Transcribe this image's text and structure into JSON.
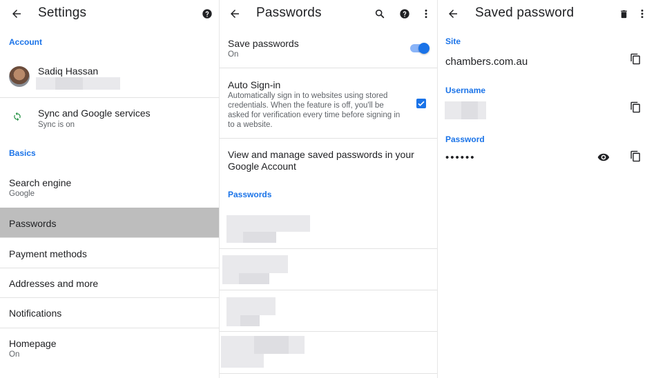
{
  "settings": {
    "title": "Settings",
    "account_label": "Account",
    "user_name": "Sadiq Hassan",
    "sync_title": "Sync and Google services",
    "sync_subtitle": "Sync is on",
    "basics_label": "Basics",
    "search_engine_title": "Search engine",
    "search_engine_value": "Google",
    "passwords": "Passwords",
    "payment_methods": "Payment methods",
    "addresses": "Addresses and more",
    "notifications": "Notifications",
    "homepage_title": "Homepage",
    "homepage_value": "On"
  },
  "passwords": {
    "title": "Passwords",
    "save_passwords_title": "Save passwords",
    "save_passwords_value": "On",
    "save_passwords_enabled": true,
    "auto_signin_title": "Auto Sign-in",
    "auto_signin_desc": "Automatically sign in to websites using stored credentials. When the feature is off, you'll be asked for verification every time before signing in to a website.",
    "auto_signin_checked": true,
    "manage_text": "View and manage saved passwords in your",
    "manage_link": "Google Account",
    "list_label": "Passwords"
  },
  "saved_password": {
    "title": "Saved password",
    "site_label": "Site",
    "site_value": "chambers.com.au",
    "username_label": "Username",
    "password_label": "Password",
    "password_masked": "••••••"
  },
  "colors": {
    "accent": "#1a73e8",
    "selected_row": "#bdbdbd"
  },
  "icons": {
    "back": "arrow-back-icon",
    "help": "help-circle-icon",
    "search": "search-icon",
    "more": "more-vert-icon",
    "delete": "trash-icon",
    "copy": "copy-icon",
    "eye": "eye-icon",
    "sync": "sync-icon"
  }
}
